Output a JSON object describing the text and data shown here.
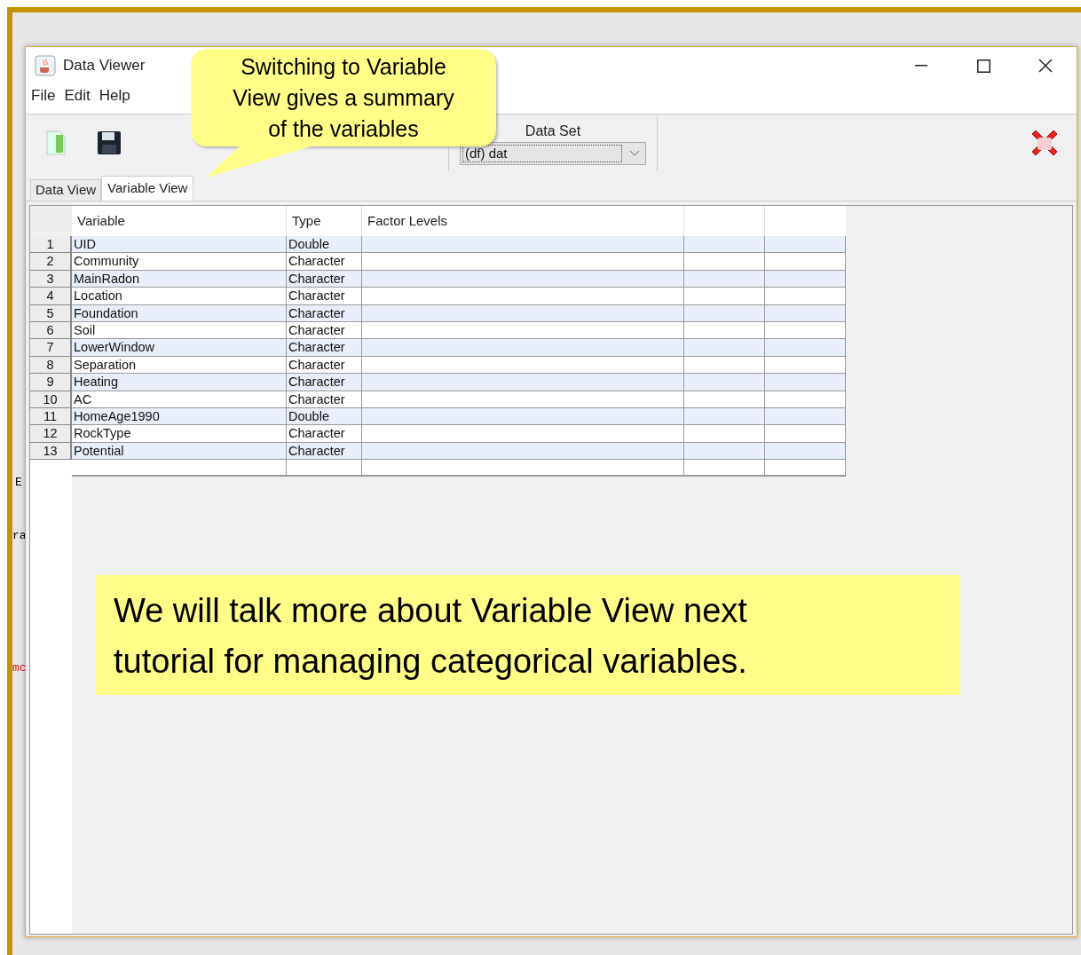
{
  "background_fragments": [
    "E",
    "ra",
    "mc"
  ],
  "window": {
    "title": "Data Viewer"
  },
  "menu": [
    "File",
    "Edit",
    "Help"
  ],
  "toolbar": {
    "dataset_label": "Data Set",
    "dataset_value": "(df) dat"
  },
  "tabs": [
    {
      "label": "Data View",
      "selected": false
    },
    {
      "label": "Variable View",
      "selected": true
    }
  ],
  "table": {
    "columns": [
      "Variable",
      "Type",
      "Factor Levels"
    ],
    "rows": [
      {
        "n": "1",
        "variable": "UID",
        "type": "Double"
      },
      {
        "n": "2",
        "variable": "Community",
        "type": "Character"
      },
      {
        "n": "3",
        "variable": "MainRadon",
        "type": "Character"
      },
      {
        "n": "4",
        "variable": "Location",
        "type": "Character"
      },
      {
        "n": "5",
        "variable": "Foundation",
        "type": "Character"
      },
      {
        "n": "6",
        "variable": "Soil",
        "type": "Character"
      },
      {
        "n": "7",
        "variable": "LowerWindow",
        "type": "Character"
      },
      {
        "n": "8",
        "variable": "Separation",
        "type": "Character"
      },
      {
        "n": "9",
        "variable": "Heating",
        "type": "Character"
      },
      {
        "n": "10",
        "variable": "AC",
        "type": "Character"
      },
      {
        "n": "11",
        "variable": "HomeAge1990",
        "type": "Double"
      },
      {
        "n": "12",
        "variable": "RockType",
        "type": "Character"
      },
      {
        "n": "13",
        "variable": "Potential",
        "type": "Character"
      }
    ]
  },
  "callout": "Switching to Variable View gives a summary of the variables",
  "note": "We will talk more about Variable View next tutorial for managing categorical variables."
}
